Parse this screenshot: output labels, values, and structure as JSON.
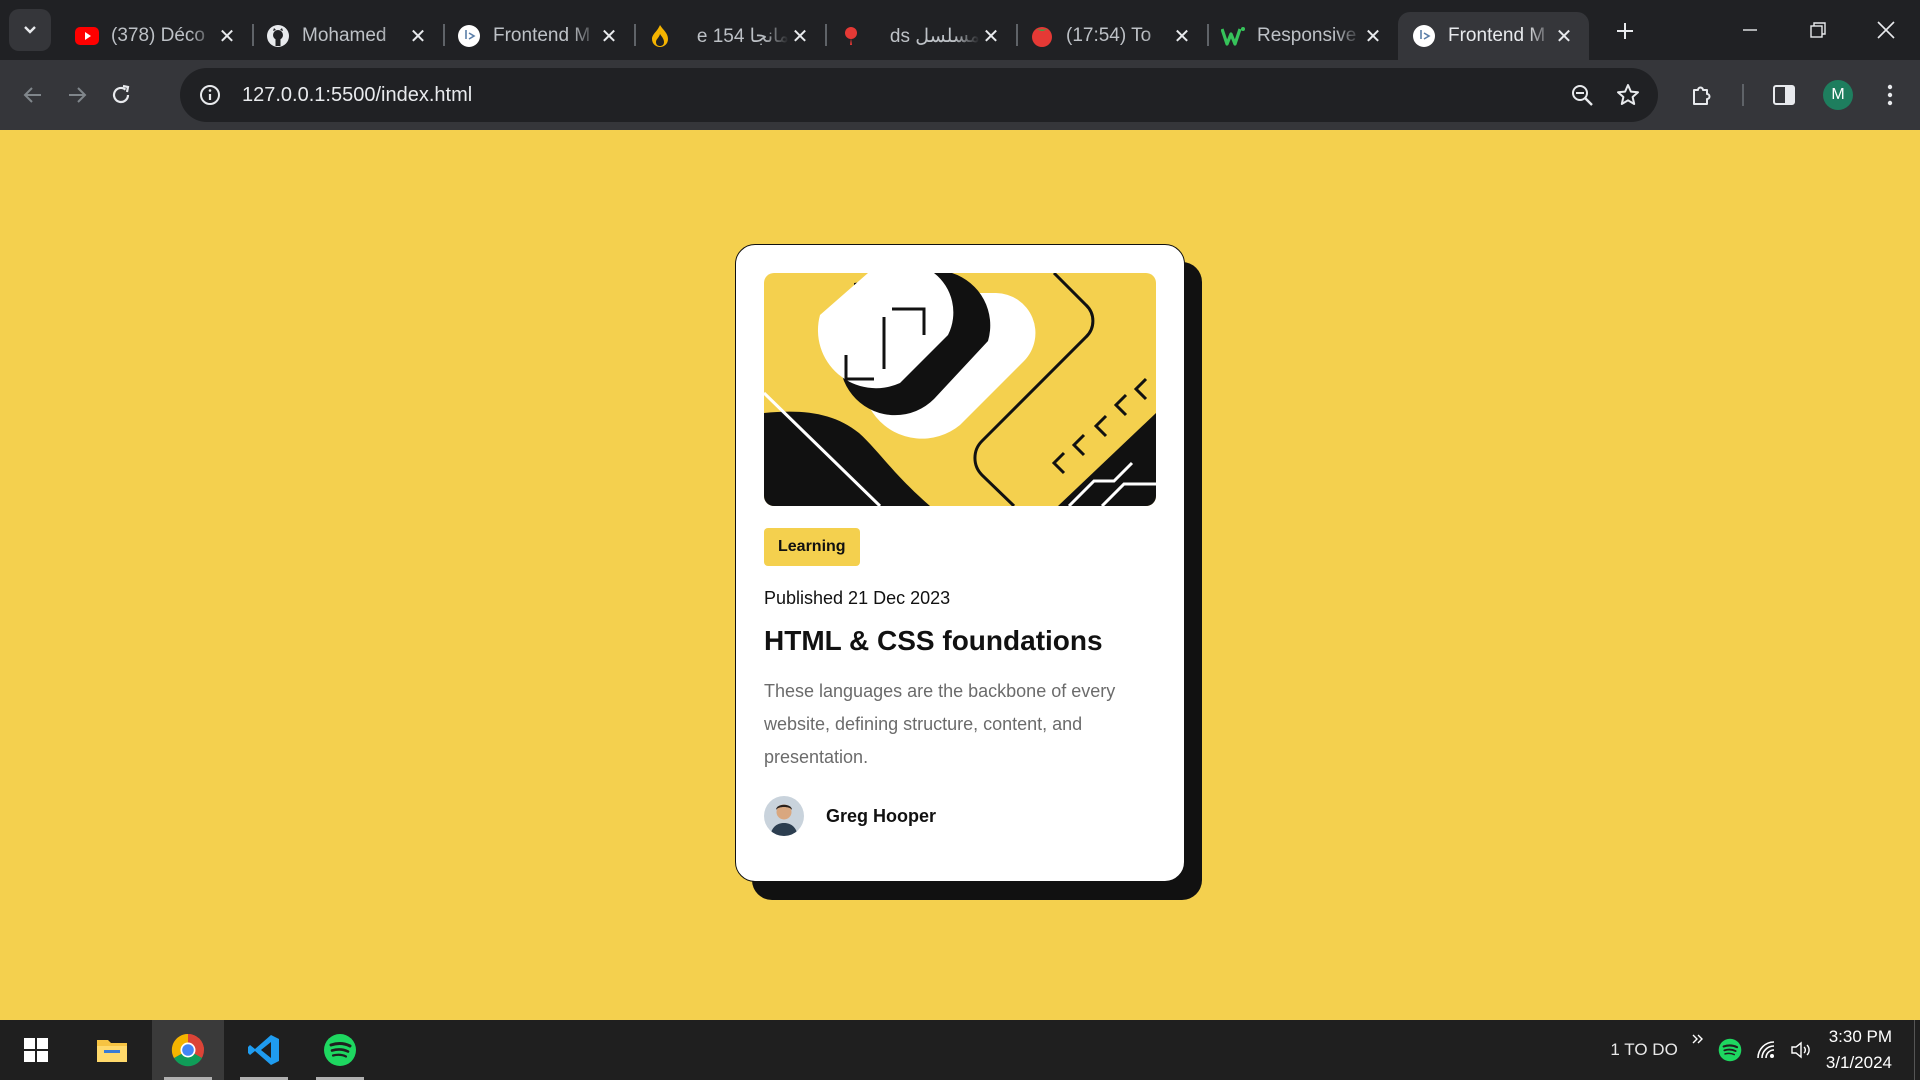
{
  "browser": {
    "tabs": [
      {
        "title": "(378) Déco",
        "icon": "youtube-icon"
      },
      {
        "title": "Mohamed",
        "icon": "github-icon"
      },
      {
        "title": "Frontend M",
        "icon": "frontend-mentor-icon"
      },
      {
        "title": "مانجا 154 e",
        "icon": "flame-icon"
      },
      {
        "title": "مسلسل ds",
        "icon": "red-pin-icon"
      },
      {
        "title": "(17:54) To",
        "icon": "tomato-icon"
      },
      {
        "title": "Responsive",
        "icon": "w-logo-icon"
      },
      {
        "title": "Frontend M",
        "icon": "frontend-mentor-icon",
        "active": true
      }
    ],
    "url": "127.0.0.1:5500/index.html",
    "profile_initial": "M"
  },
  "card": {
    "tag": "Learning",
    "published": "Published 21 Dec 2023",
    "title": "HTML & CSS foundations",
    "description": "These languages are the backbone of every website, defining structure, content, and presentation.",
    "author": "Greg Hooper"
  },
  "taskbar": {
    "apps": [
      "windows-start-icon",
      "file-explorer-icon",
      "chrome-icon",
      "vscode-icon",
      "spotify-icon"
    ],
    "todo": "1 TO DO",
    "time": "3:30 PM",
    "date": "3/1/2024"
  },
  "colors": {
    "page_bg": "#f4d04e",
    "card_bg": "#ffffff",
    "text_dark": "#111111",
    "text_grey": "#6b6b6b"
  }
}
